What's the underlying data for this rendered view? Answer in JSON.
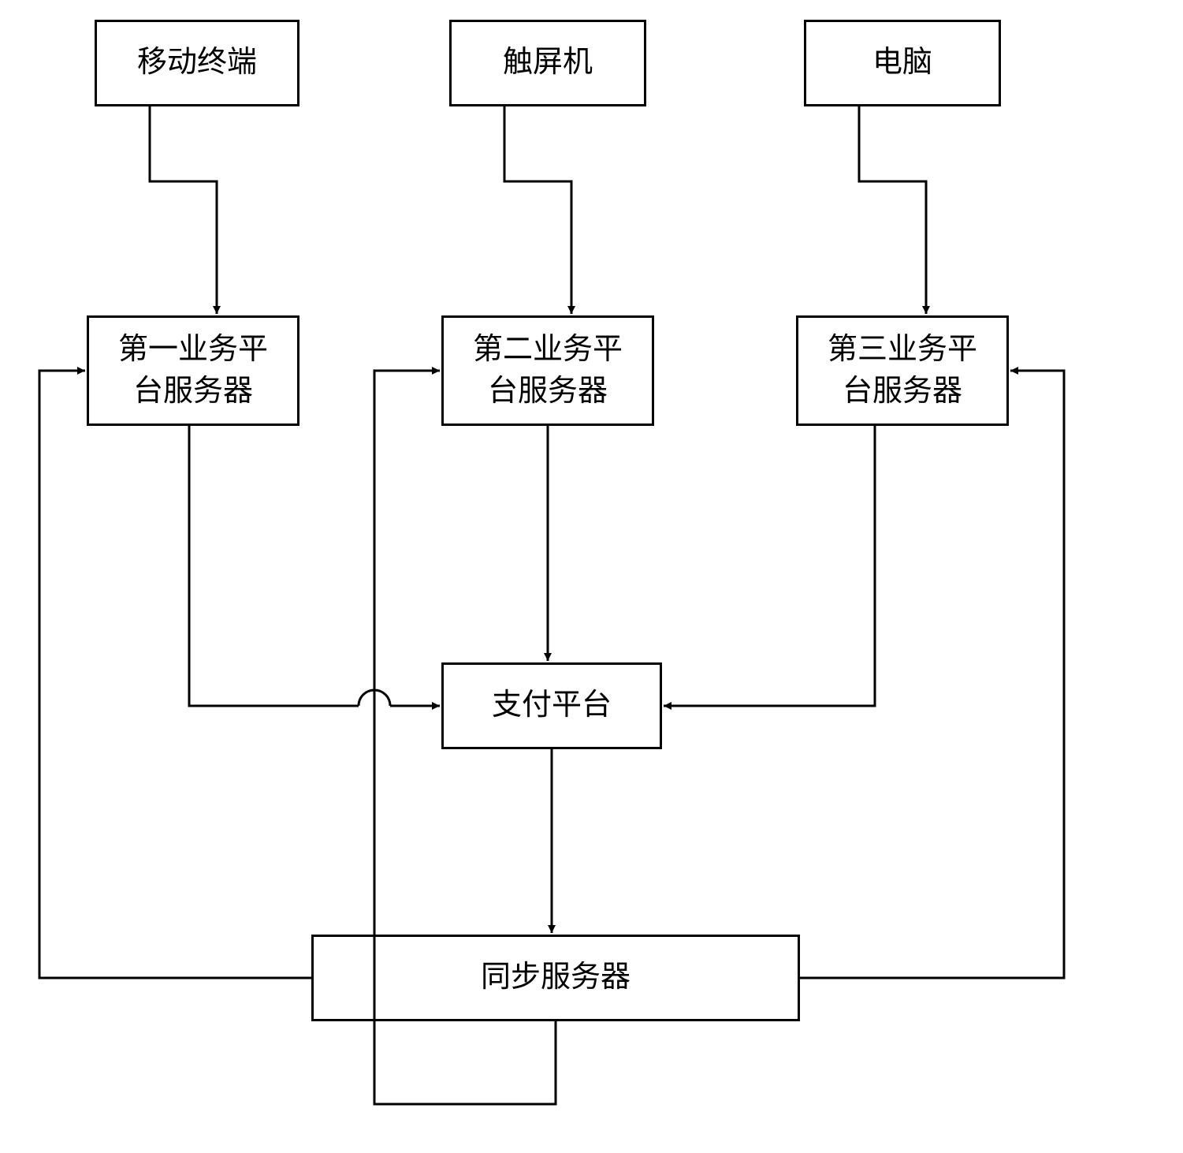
{
  "nodes": {
    "mobile_terminal": "移动终端",
    "touch_machine": "触屏机",
    "computer": "电脑",
    "platform1": "第一业务平\n台服务器",
    "platform2": "第二业务平\n台服务器",
    "platform3": "第三业务平\n台服务器",
    "pay_platform": "支付平台",
    "sync_server": "同步服务器"
  }
}
